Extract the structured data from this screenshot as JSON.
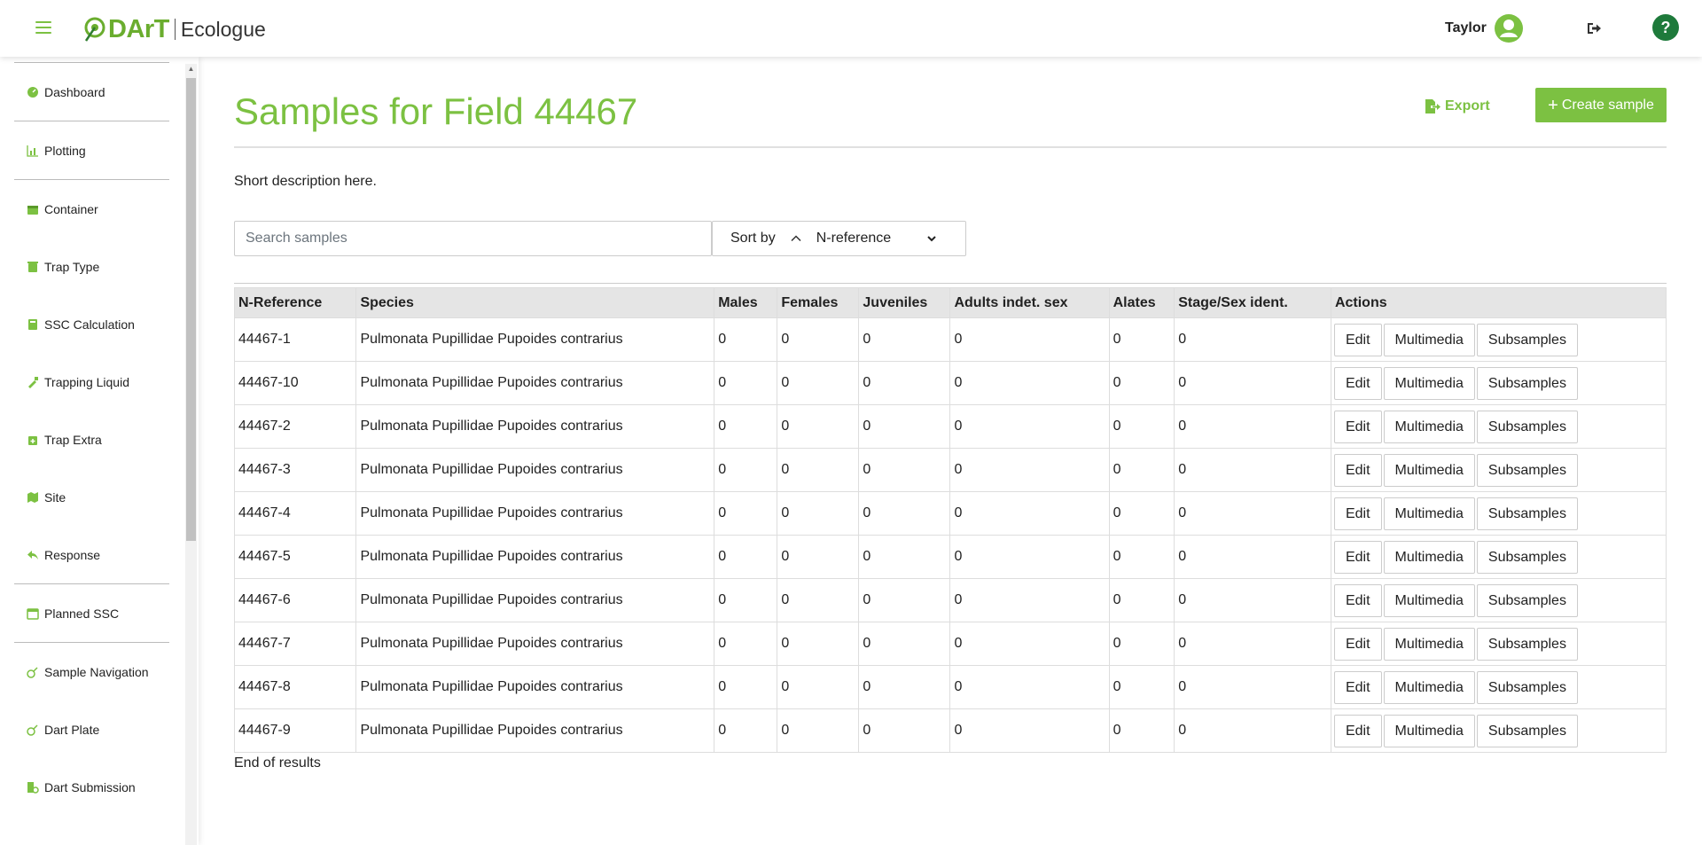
{
  "header": {
    "logo_text": "DArT",
    "logo_subtitle": "Ecologue",
    "user_name": "Taylor",
    "help_label": "?"
  },
  "sidebar": {
    "items": [
      {
        "label": "Dashboard",
        "icon": "dashboard-icon"
      },
      {
        "label": "Plotting",
        "icon": "plotting-icon"
      },
      {
        "label": "Container",
        "icon": "container-icon"
      },
      {
        "label": "Trap Type",
        "icon": "trap-type-icon"
      },
      {
        "label": "SSC Calculation",
        "icon": "calculator-icon"
      },
      {
        "label": "Trapping Liquid",
        "icon": "dropper-icon"
      },
      {
        "label": "Trap Extra",
        "icon": "trap-extra-icon"
      },
      {
        "label": "Site",
        "icon": "map-icon"
      },
      {
        "label": "Response",
        "icon": "reply-icon"
      },
      {
        "label": "Planned SSC",
        "icon": "calendar-icon"
      },
      {
        "label": "Sample Navigation",
        "icon": "sample-icon"
      },
      {
        "label": "Dart Plate",
        "icon": "plate-icon"
      },
      {
        "label": "Dart Submission",
        "icon": "submission-icon"
      }
    ]
  },
  "page": {
    "title": "Samples for Field 44467",
    "export_label": "Export",
    "create_label": "Create sample",
    "description": "Short description here.",
    "search_placeholder": "Search samples",
    "sort_label": "Sort by",
    "sort_value": "N-reference",
    "end_text": "End of results"
  },
  "table": {
    "headers": [
      "N-Reference",
      "Species",
      "Males",
      "Females",
      "Juveniles",
      "Adults indet. sex",
      "Alates",
      "Stage/Sex ident.",
      "Actions"
    ],
    "action_labels": [
      "Edit",
      "Multimedia",
      "Subsamples"
    ],
    "rows": [
      [
        "44467-1",
        "Pulmonata Pupillidae Pupoides contrarius",
        "0",
        "0",
        "0",
        "0",
        "0",
        "0"
      ],
      [
        "44467-10",
        "Pulmonata Pupillidae Pupoides contrarius",
        "0",
        "0",
        "0",
        "0",
        "0",
        "0"
      ],
      [
        "44467-2",
        "Pulmonata Pupillidae Pupoides contrarius",
        "0",
        "0",
        "0",
        "0",
        "0",
        "0"
      ],
      [
        "44467-3",
        "Pulmonata Pupillidae Pupoides contrarius",
        "0",
        "0",
        "0",
        "0",
        "0",
        "0"
      ],
      [
        "44467-4",
        "Pulmonata Pupillidae Pupoides contrarius",
        "0",
        "0",
        "0",
        "0",
        "0",
        "0"
      ],
      [
        "44467-5",
        "Pulmonata Pupillidae Pupoides contrarius",
        "0",
        "0",
        "0",
        "0",
        "0",
        "0"
      ],
      [
        "44467-6",
        "Pulmonata Pupillidae Pupoides contrarius",
        "0",
        "0",
        "0",
        "0",
        "0",
        "0"
      ],
      [
        "44467-7",
        "Pulmonata Pupillidae Pupoides contrarius",
        "0",
        "0",
        "0",
        "0",
        "0",
        "0"
      ],
      [
        "44467-8",
        "Pulmonata Pupillidae Pupoides contrarius",
        "0",
        "0",
        "0",
        "0",
        "0",
        "0"
      ],
      [
        "44467-9",
        "Pulmonata Pupillidae Pupoides contrarius",
        "0",
        "0",
        "0",
        "0",
        "0",
        "0"
      ]
    ]
  },
  "colors": {
    "accent": "#7cc142",
    "help_bg": "#1e7a3b",
    "header_row_bg": "#e5e5e5"
  }
}
